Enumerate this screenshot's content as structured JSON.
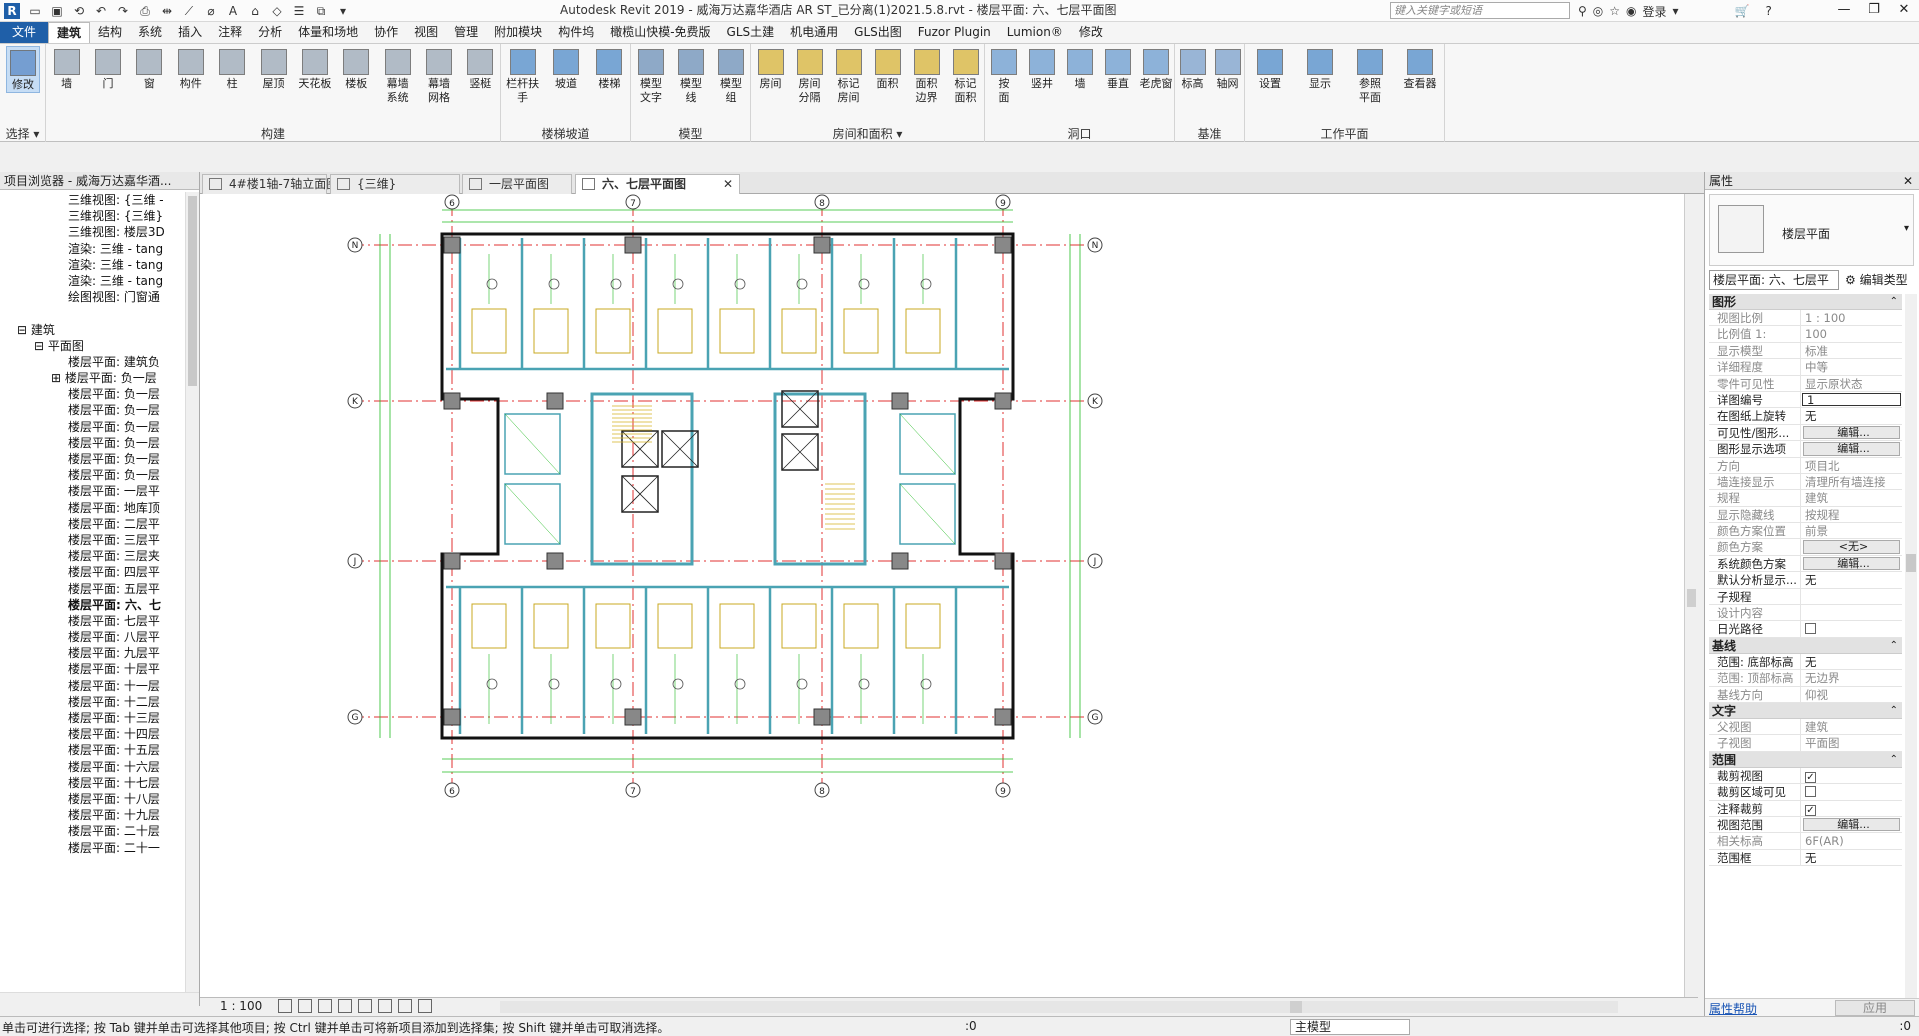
{
  "app": {
    "title": "Autodesk Revit 2019 - 威海万达嘉华酒店 AR ST_已分离(1)2021.5.8.rvt - 楼层平面: 六、七层平面图",
    "search_placeholder": "键入关键字或短语",
    "signin_label": "登录"
  },
  "menu": {
    "items": [
      "文件",
      "建筑",
      "结构",
      "系统",
      "插入",
      "注释",
      "分析",
      "体量和场地",
      "协作",
      "视图",
      "管理",
      "附加模块",
      "构件坞",
      "橄榄山快模-免费版",
      "GLS土建",
      "机电通用",
      "GLS出图",
      "Fuzor Plugin",
      "Lumion®",
      "修改"
    ],
    "active_index": 1
  },
  "ribbon": {
    "groups": [
      {
        "title": "选择 ▾",
        "buttons": [
          "修改"
        ]
      },
      {
        "title": "构建",
        "buttons": [
          "墙",
          "门",
          "窗",
          "构件",
          "柱",
          "屋顶",
          "天花板",
          "楼板",
          "幕墙\n系统",
          "幕墙\n网格",
          "竖梃"
        ]
      },
      {
        "title": "楼梯坡道",
        "buttons": [
          "栏杆扶手",
          "坡道",
          "楼梯"
        ]
      },
      {
        "title": "模型",
        "buttons": [
          "模型\n文字",
          "模型\n线",
          "模型\n组"
        ]
      },
      {
        "title": "房间和面积 ▾",
        "buttons": [
          "房间",
          "房间\n分隔",
          "标记\n房间",
          "面积",
          "面积\n边界",
          "标记\n面积"
        ]
      },
      {
        "title": "洞口",
        "buttons": [
          "按\n面",
          "竖井",
          "墙",
          "垂直",
          "老虎窗"
        ]
      },
      {
        "title": "基准",
        "buttons": [
          "标高",
          "轴网"
        ]
      },
      {
        "title": "工作平面",
        "buttons": [
          "设置",
          "显示",
          "参照\n平面",
          "查看器"
        ]
      }
    ]
  },
  "project_browser": {
    "title": "项目浏览器 - 威海万达嘉华酒...",
    "items": [
      {
        "label": "三维视图: {三维 -",
        "indent": 4
      },
      {
        "label": "三维视图: {三维}",
        "indent": 4
      },
      {
        "label": "三维视图: 楼层3D",
        "indent": 4
      },
      {
        "label": "渲染: 三维 - tang",
        "indent": 4
      },
      {
        "label": "渲染: 三维 - tang",
        "indent": 4
      },
      {
        "label": "渲染: 三维 - tang",
        "indent": 4
      },
      {
        "label": "绘图视图: 门窗通",
        "indent": 4
      },
      {
        "label": "",
        "indent": 0
      },
      {
        "label": "⊟ 建筑",
        "indent": 1
      },
      {
        "label": "⊟ 平面图",
        "indent": 2
      },
      {
        "label": "楼层平面: 建筑负",
        "indent": 4
      },
      {
        "label": "⊞ 楼层平面: 负一层",
        "indent": 3
      },
      {
        "label": "楼层平面: 负一层",
        "indent": 4
      },
      {
        "label": "楼层平面: 负一层",
        "indent": 4
      },
      {
        "label": "楼层平面: 负一层",
        "indent": 4
      },
      {
        "label": "楼层平面: 负一层",
        "indent": 4
      },
      {
        "label": "楼层平面: 负一层",
        "indent": 4
      },
      {
        "label": "楼层平面: 负一层",
        "indent": 4
      },
      {
        "label": "楼层平面: 一层平",
        "indent": 4
      },
      {
        "label": "楼层平面: 地库顶",
        "indent": 4
      },
      {
        "label": "楼层平面: 二层平",
        "indent": 4
      },
      {
        "label": "楼层平面: 三层平",
        "indent": 4
      },
      {
        "label": "楼层平面: 三层夹",
        "indent": 4
      },
      {
        "label": "楼层平面: 四层平",
        "indent": 4
      },
      {
        "label": "楼层平面: 五层平",
        "indent": 4
      },
      {
        "label": "楼层平面: 六、七",
        "indent": 4,
        "bold": true
      },
      {
        "label": "楼层平面: 七层平",
        "indent": 4
      },
      {
        "label": "楼层平面: 八层平",
        "indent": 4
      },
      {
        "label": "楼层平面: 九层平",
        "indent": 4
      },
      {
        "label": "楼层平面: 十层平",
        "indent": 4
      },
      {
        "label": "楼层平面: 十一层",
        "indent": 4
      },
      {
        "label": "楼层平面: 十二层",
        "indent": 4
      },
      {
        "label": "楼层平面: 十三层",
        "indent": 4
      },
      {
        "label": "楼层平面: 十四层",
        "indent": 4
      },
      {
        "label": "楼层平面: 十五层",
        "indent": 4
      },
      {
        "label": "楼层平面: 十六层",
        "indent": 4
      },
      {
        "label": "楼层平面: 十七层",
        "indent": 4
      },
      {
        "label": "楼层平面: 十八层",
        "indent": 4
      },
      {
        "label": "楼层平面: 十九层",
        "indent": 4
      },
      {
        "label": "楼层平面: 二十层",
        "indent": 4
      },
      {
        "label": "楼层平面: 二十一",
        "indent": 4
      }
    ]
  },
  "view_tabs": [
    {
      "label": "4#楼1轴-7轴立面图",
      "active": false
    },
    {
      "label": "{三维}",
      "active": false
    },
    {
      "label": "一层平面图",
      "active": false
    },
    {
      "label": "六、七层平面图",
      "active": true
    }
  ],
  "drawing": {
    "grid_top": [
      "6",
      "7",
      "8",
      "9"
    ],
    "grid_side": [
      "N",
      "K",
      "J",
      "G"
    ]
  },
  "view_control": {
    "scale": "1 : 100"
  },
  "properties": {
    "title": "属性",
    "type_name": "楼层平面",
    "instance_selector": "楼层平面: 六、七层平",
    "edit_type": "编辑类型",
    "sections": [
      {
        "name": "图形",
        "rows": [
          {
            "k": "视图比例",
            "v": "1 : 100",
            "dim": true
          },
          {
            "k": "比例值 1:",
            "v": "100",
            "dim": true
          },
          {
            "k": "显示模型",
            "v": "标准",
            "dim": true
          },
          {
            "k": "详细程度",
            "v": "中等",
            "dim": true
          },
          {
            "k": "零件可见性",
            "v": "显示原状态",
            "dim": true
          },
          {
            "k": "详图编号",
            "v": "1",
            "kind": "input"
          },
          {
            "k": "在图纸上旋转",
            "v": "无"
          },
          {
            "k": "可见性/图形...",
            "v": "编辑...",
            "kind": "btn"
          },
          {
            "k": "图形显示选项",
            "v": "编辑...",
            "kind": "btn"
          },
          {
            "k": "方向",
            "v": "项目北",
            "dim": true
          },
          {
            "k": "墙连接显示",
            "v": "清理所有墙连接",
            "dim": true
          },
          {
            "k": "规程",
            "v": "建筑",
            "dim": true
          },
          {
            "k": "显示隐藏线",
            "v": "按规程",
            "dim": true
          },
          {
            "k": "颜色方案位置",
            "v": "前景",
            "dim": true
          },
          {
            "k": "颜色方案",
            "v": "<无>",
            "kind": "btn",
            "dim": true
          },
          {
            "k": "系统颜色方案",
            "v": "编辑...",
            "kind": "btn"
          },
          {
            "k": "默认分析显示...",
            "v": "无"
          },
          {
            "k": "子规程",
            "v": ""
          },
          {
            "k": "设计内容",
            "v": "",
            "dim": true
          },
          {
            "k": "日光路径",
            "v": "",
            "kind": "check",
            "checked": false
          }
        ]
      },
      {
        "name": "基线",
        "rows": [
          {
            "k": "范围: 底部标高",
            "v": "无"
          },
          {
            "k": "范围: 顶部标高",
            "v": "无边界",
            "dim": true
          },
          {
            "k": "基线方向",
            "v": "仰视",
            "dim": true
          }
        ]
      },
      {
        "name": "文字",
        "rows": [
          {
            "k": "父视图",
            "v": "建筑",
            "dim": true
          },
          {
            "k": "子视图",
            "v": "平面图",
            "dim": true
          }
        ]
      },
      {
        "name": "范围",
        "rows": [
          {
            "k": "裁剪视图",
            "v": "",
            "kind": "check",
            "checked": true
          },
          {
            "k": "裁剪区域可见",
            "v": "",
            "kind": "check",
            "checked": false
          },
          {
            "k": "注释裁剪",
            "v": "",
            "kind": "check",
            "checked": true
          },
          {
            "k": "视图范围",
            "v": "编辑...",
            "kind": "btn"
          },
          {
            "k": "相关标高",
            "v": "6F(AR)",
            "dim": true
          },
          {
            "k": "范围框",
            "v": "无"
          }
        ]
      }
    ],
    "help_link": "属性帮助",
    "apply_button": "应用"
  },
  "statusbar": {
    "message": "单击可进行选择; 按 Tab 键并单击可选择其他项目; 按 Ctrl 键并单击可将新项目添加到选择集; 按 Shift 键并单击可取消选择。",
    "selection_count": ":0",
    "model": "主模型",
    "filter_count": ":0"
  }
}
